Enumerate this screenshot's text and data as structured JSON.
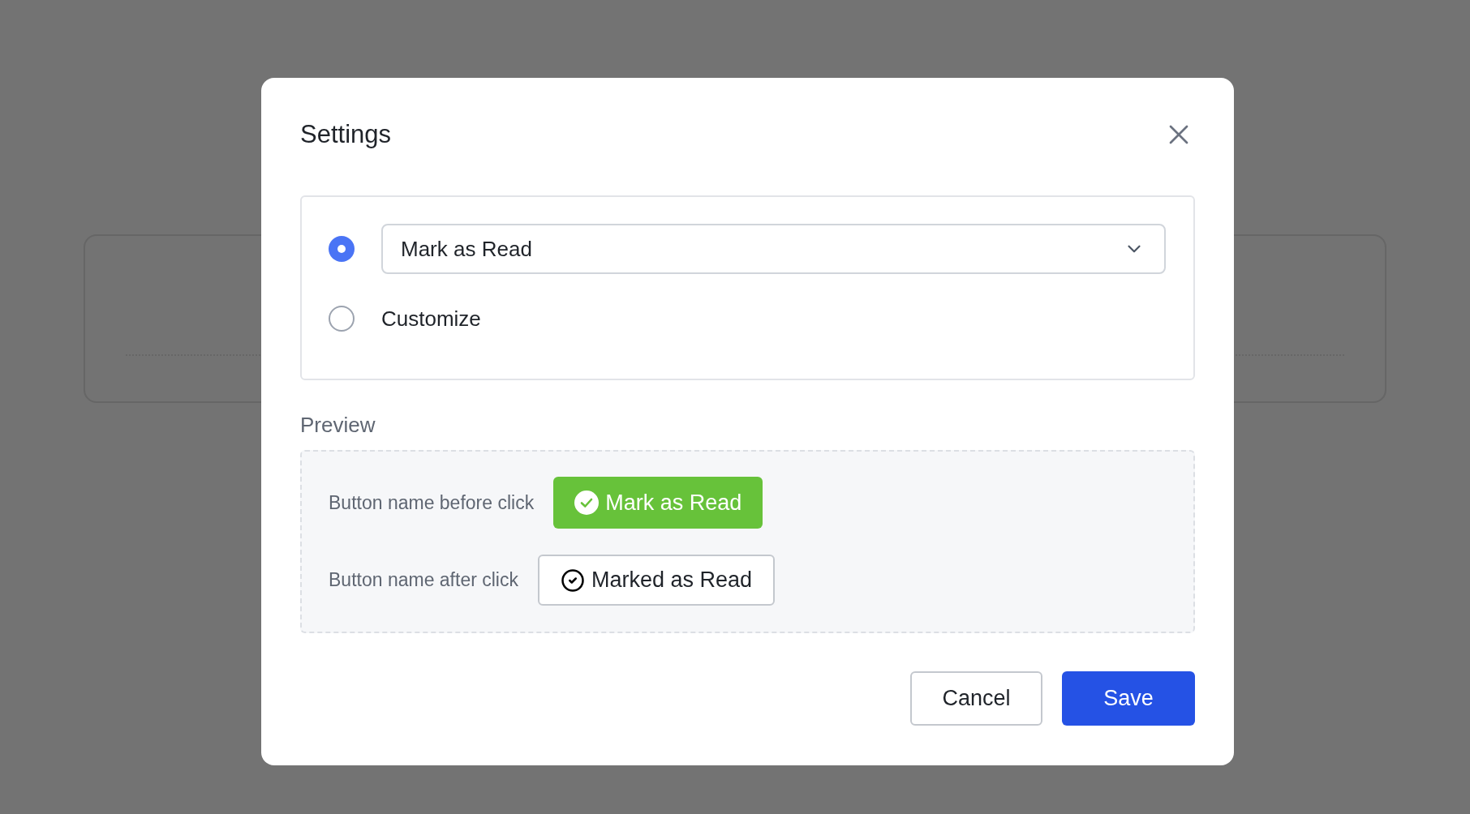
{
  "dialog": {
    "title": "Settings",
    "options": [
      {
        "kind": "select",
        "selected": true,
        "value": "Mark as Read"
      },
      {
        "kind": "text",
        "selected": false,
        "label": "Customize"
      }
    ],
    "preview": {
      "title": "Preview",
      "rows": [
        {
          "label": "Button name before click",
          "button": "Mark as Read",
          "kind": "filled"
        },
        {
          "label": "Button name after click",
          "button": "Marked as Read",
          "kind": "outline"
        }
      ]
    },
    "buttons": [
      {
        "label": "Cancel",
        "kind": "secondary"
      },
      {
        "label": "Save",
        "kind": "primary"
      }
    ]
  }
}
